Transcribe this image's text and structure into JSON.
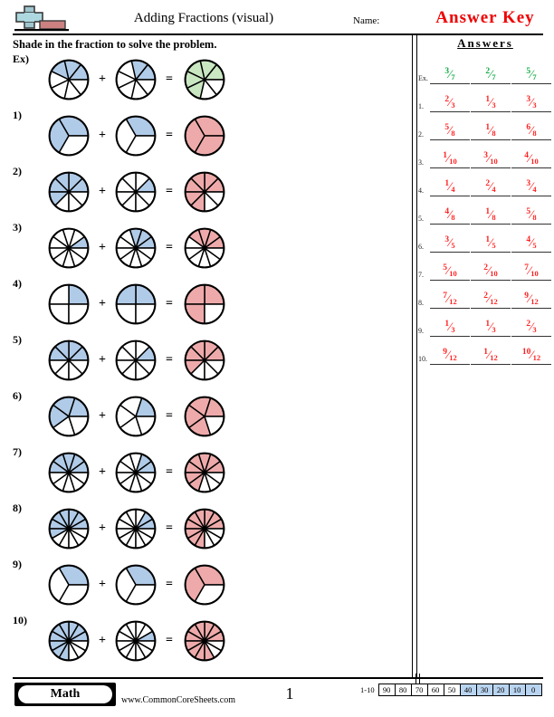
{
  "header": {
    "title": "Adding Fractions (visual)",
    "name_label": "Name:",
    "answer_key": "Answer Key",
    "logo_icon": "plus-block-logo"
  },
  "instructions": "Shade in the fraction to solve the problem.",
  "answers_panel": {
    "title": "Answers"
  },
  "footer": {
    "subject_badge": "Math",
    "site_url": "www.CommonCoreSheets.com",
    "page_number": "1",
    "grade_range": "1-10",
    "grade_boxes": [
      {
        "value": "90",
        "highlighted": false
      },
      {
        "value": "80",
        "highlighted": false
      },
      {
        "value": "70",
        "highlighted": false
      },
      {
        "value": "60",
        "highlighted": false
      },
      {
        "value": "50",
        "highlighted": false
      },
      {
        "value": "40",
        "highlighted": true
      },
      {
        "value": "30",
        "highlighted": true
      },
      {
        "value": "20",
        "highlighted": true
      },
      {
        "value": "10",
        "highlighted": true
      },
      {
        "value": "0",
        "highlighted": true
      }
    ]
  },
  "colors": {
    "addend_fill": "#b0cbe8",
    "sum_fill": "#eeaaaa",
    "example_sum_fill": "#c9e8c2",
    "answer_red": "#ff2222",
    "answer_green": "#11aa44",
    "logo_blue": "#add8e0",
    "logo_red": "#cc8080"
  },
  "operators": {
    "plus": "+",
    "equals": "="
  },
  "problems": [
    {
      "label": "Ex)",
      "answer_label": "Ex.",
      "denominator": 7,
      "addend1": 3,
      "addend2": 2,
      "sum": 5,
      "is_example": true
    },
    {
      "label": "1)",
      "answer_label": "1.",
      "denominator": 3,
      "addend1": 2,
      "addend2": 1,
      "sum": 3,
      "is_example": false
    },
    {
      "label": "2)",
      "answer_label": "2.",
      "denominator": 8,
      "addend1": 5,
      "addend2": 1,
      "sum": 6,
      "is_example": false
    },
    {
      "label": "3)",
      "answer_label": "3.",
      "denominator": 10,
      "addend1": 1,
      "addend2": 3,
      "sum": 4,
      "is_example": false
    },
    {
      "label": "4)",
      "answer_label": "4.",
      "denominator": 4,
      "addend1": 1,
      "addend2": 2,
      "sum": 3,
      "is_example": false
    },
    {
      "label": "5)",
      "answer_label": "5.",
      "denominator": 8,
      "addend1": 4,
      "addend2": 1,
      "sum": 5,
      "is_example": false
    },
    {
      "label": "6)",
      "answer_label": "6.",
      "denominator": 5,
      "addend1": 3,
      "addend2": 1,
      "sum": 4,
      "is_example": false
    },
    {
      "label": "7)",
      "answer_label": "7.",
      "denominator": 10,
      "addend1": 5,
      "addend2": 2,
      "sum": 7,
      "is_example": false
    },
    {
      "label": "8)",
      "answer_label": "8.",
      "denominator": 12,
      "addend1": 7,
      "addend2": 2,
      "sum": 9,
      "is_example": false
    },
    {
      "label": "9)",
      "answer_label": "9.",
      "denominator": 3,
      "addend1": 1,
      "addend2": 1,
      "sum": 2,
      "is_example": false
    },
    {
      "label": "10)",
      "answer_label": "10.",
      "denominator": 12,
      "addend1": 9,
      "addend2": 1,
      "sum": 10,
      "is_example": false
    }
  ]
}
